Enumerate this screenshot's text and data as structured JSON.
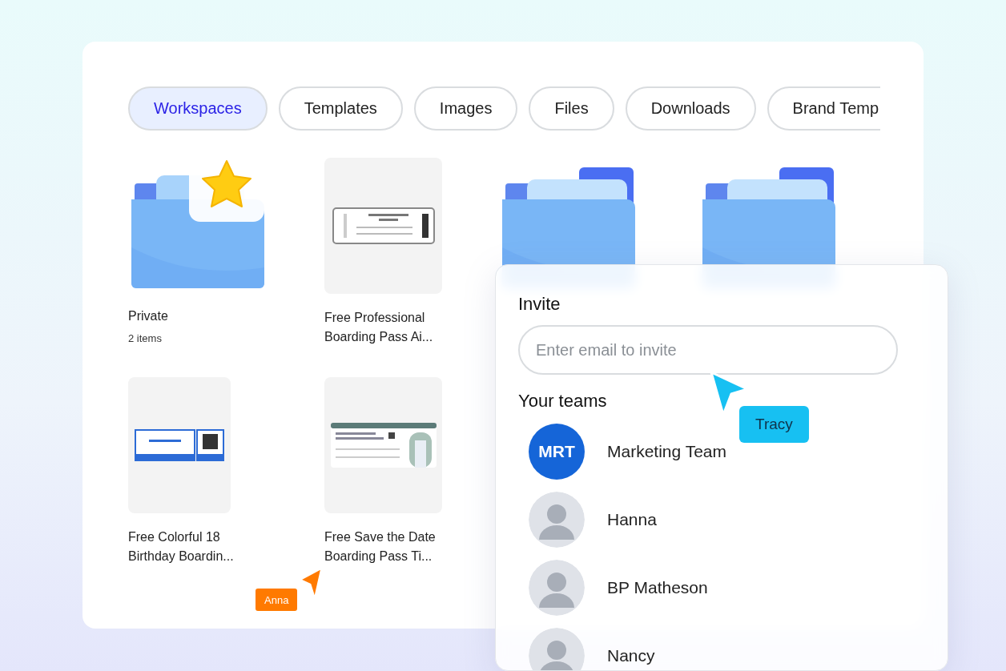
{
  "tabs": [
    {
      "label": "Workspaces",
      "selected": true
    },
    {
      "label": "Templates",
      "selected": false
    },
    {
      "label": "Images",
      "selected": false
    },
    {
      "label": "Files",
      "selected": false
    },
    {
      "label": "Downloads",
      "selected": false
    },
    {
      "label": "Brand Temp",
      "selected": false
    }
  ],
  "items": [
    {
      "kind": "folder",
      "starred": true,
      "title": "Private",
      "subtitle": "2 items"
    },
    {
      "kind": "ticket",
      "title": "Free Professional Boarding Pass Ai..."
    },
    {
      "kind": "folder",
      "starred": false
    },
    {
      "kind": "folder",
      "starred": false
    },
    {
      "kind": "pass",
      "title": "Free Colorful 18 Birthday Boardin..."
    },
    {
      "kind": "invitation",
      "title": "Free Save the Date Boarding Pass Ti..."
    }
  ],
  "invite": {
    "title": "Invite",
    "placeholder": "Enter email to invite",
    "teams_title": "Your teams",
    "members": [
      {
        "kind": "team",
        "initials": "MRT",
        "name": "Marketing Team"
      },
      {
        "kind": "person",
        "name": "Hanna"
      },
      {
        "kind": "person",
        "name": "BP Matheson"
      },
      {
        "kind": "person",
        "name": "Nancy"
      }
    ]
  },
  "cursors": [
    {
      "name": "Tracy",
      "color": "#17c0f2"
    },
    {
      "name": "Anna",
      "color": "#ff7a00"
    }
  ]
}
